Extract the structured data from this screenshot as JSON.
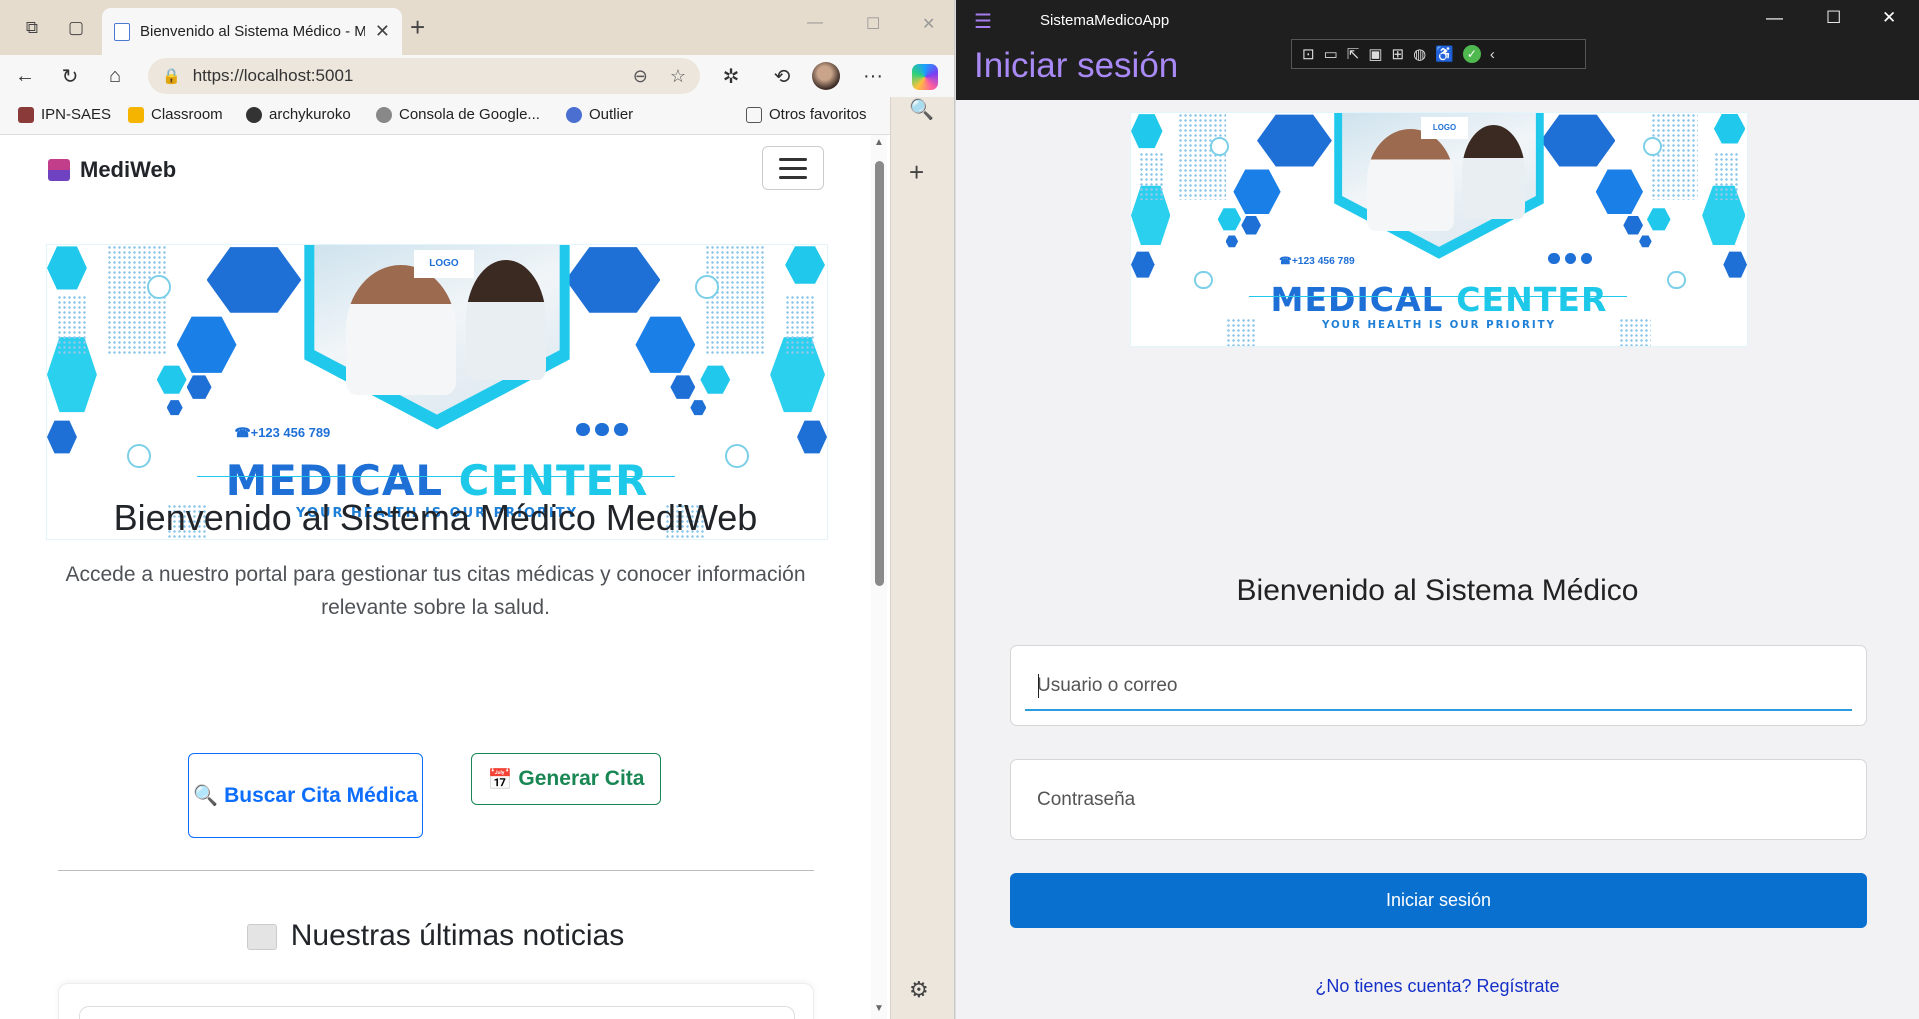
{
  "browser": {
    "tab_title": "Bienvenido al Sistema Médico - M",
    "url": "https://localhost:5001",
    "bookmarks": [
      {
        "label": "IPN-SAES",
        "color": "#8b3a3a"
      },
      {
        "label": "Classroom",
        "color": "#f4b400"
      },
      {
        "label": "archykuroko",
        "color": "#333333"
      },
      {
        "label": "Consola de Google...",
        "color": "#777777"
      },
      {
        "label": "Outlier",
        "color": "#4a6fd0"
      },
      {
        "label": "Otros favoritos",
        "color": "#555555"
      }
    ],
    "icons": {
      "workspaces": "⧉",
      "tab_actions": "▢",
      "close": "✕",
      "new_tab": "+",
      "minimize": "—",
      "maximize": "☐",
      "back": "←",
      "refresh": "↻",
      "home": "⌂",
      "lock": "🔒",
      "zoom": "⊖",
      "favorite": "☆",
      "extensions": "✲",
      "history": "⟲",
      "more": "···",
      "search": "🔍",
      "add": "+",
      "settings": "⚙"
    }
  },
  "page": {
    "brand": "MediWeb",
    "hero_title": "Bienvenido al Sistema Médico MediWeb",
    "hero_lead": "Accede a nuestro portal para gestionar tus citas médicas y conocer información relevante sobre la salud.",
    "buttons": {
      "search_label": "Buscar Cita Médica",
      "generate_label": "Generar Cita",
      "search_icon": "🔍",
      "generate_icon": "📅"
    },
    "news_title": "Nuestras últimas noticias"
  },
  "banner": {
    "logo": "LOGO",
    "phone": "+123 456 789",
    "title_part1": "MEDICAL",
    "title_part2": "CENTER",
    "subtitle": "YOUR HEALTH IS OUR PRIORITY",
    "colors": {
      "blue": "#1e6fd6",
      "cyan": "#1ec8e8"
    }
  },
  "app": {
    "window_title": "SistemaMedicoApp",
    "page_title": "Iniciar sesión",
    "welcome": "Bienvenido al Sistema Médico",
    "user_placeholder": "Usuario o correo",
    "password_placeholder": "Contraseña",
    "login_button": "Iniciar sesión",
    "register_link": "¿No tienes cuenta? Regístrate",
    "devtools": [
      "⊡",
      "▭",
      "⇱",
      "▣",
      "⊞",
      "◍",
      "♿",
      "✓",
      "‹"
    ],
    "window_buttons": {
      "minimize": "—",
      "maximize": "☐",
      "close": "✕"
    },
    "menu_icon": "☰",
    "colors": {
      "accent": "#a889f5",
      "primary": "#0a70d0",
      "link": "#1530c7"
    }
  }
}
